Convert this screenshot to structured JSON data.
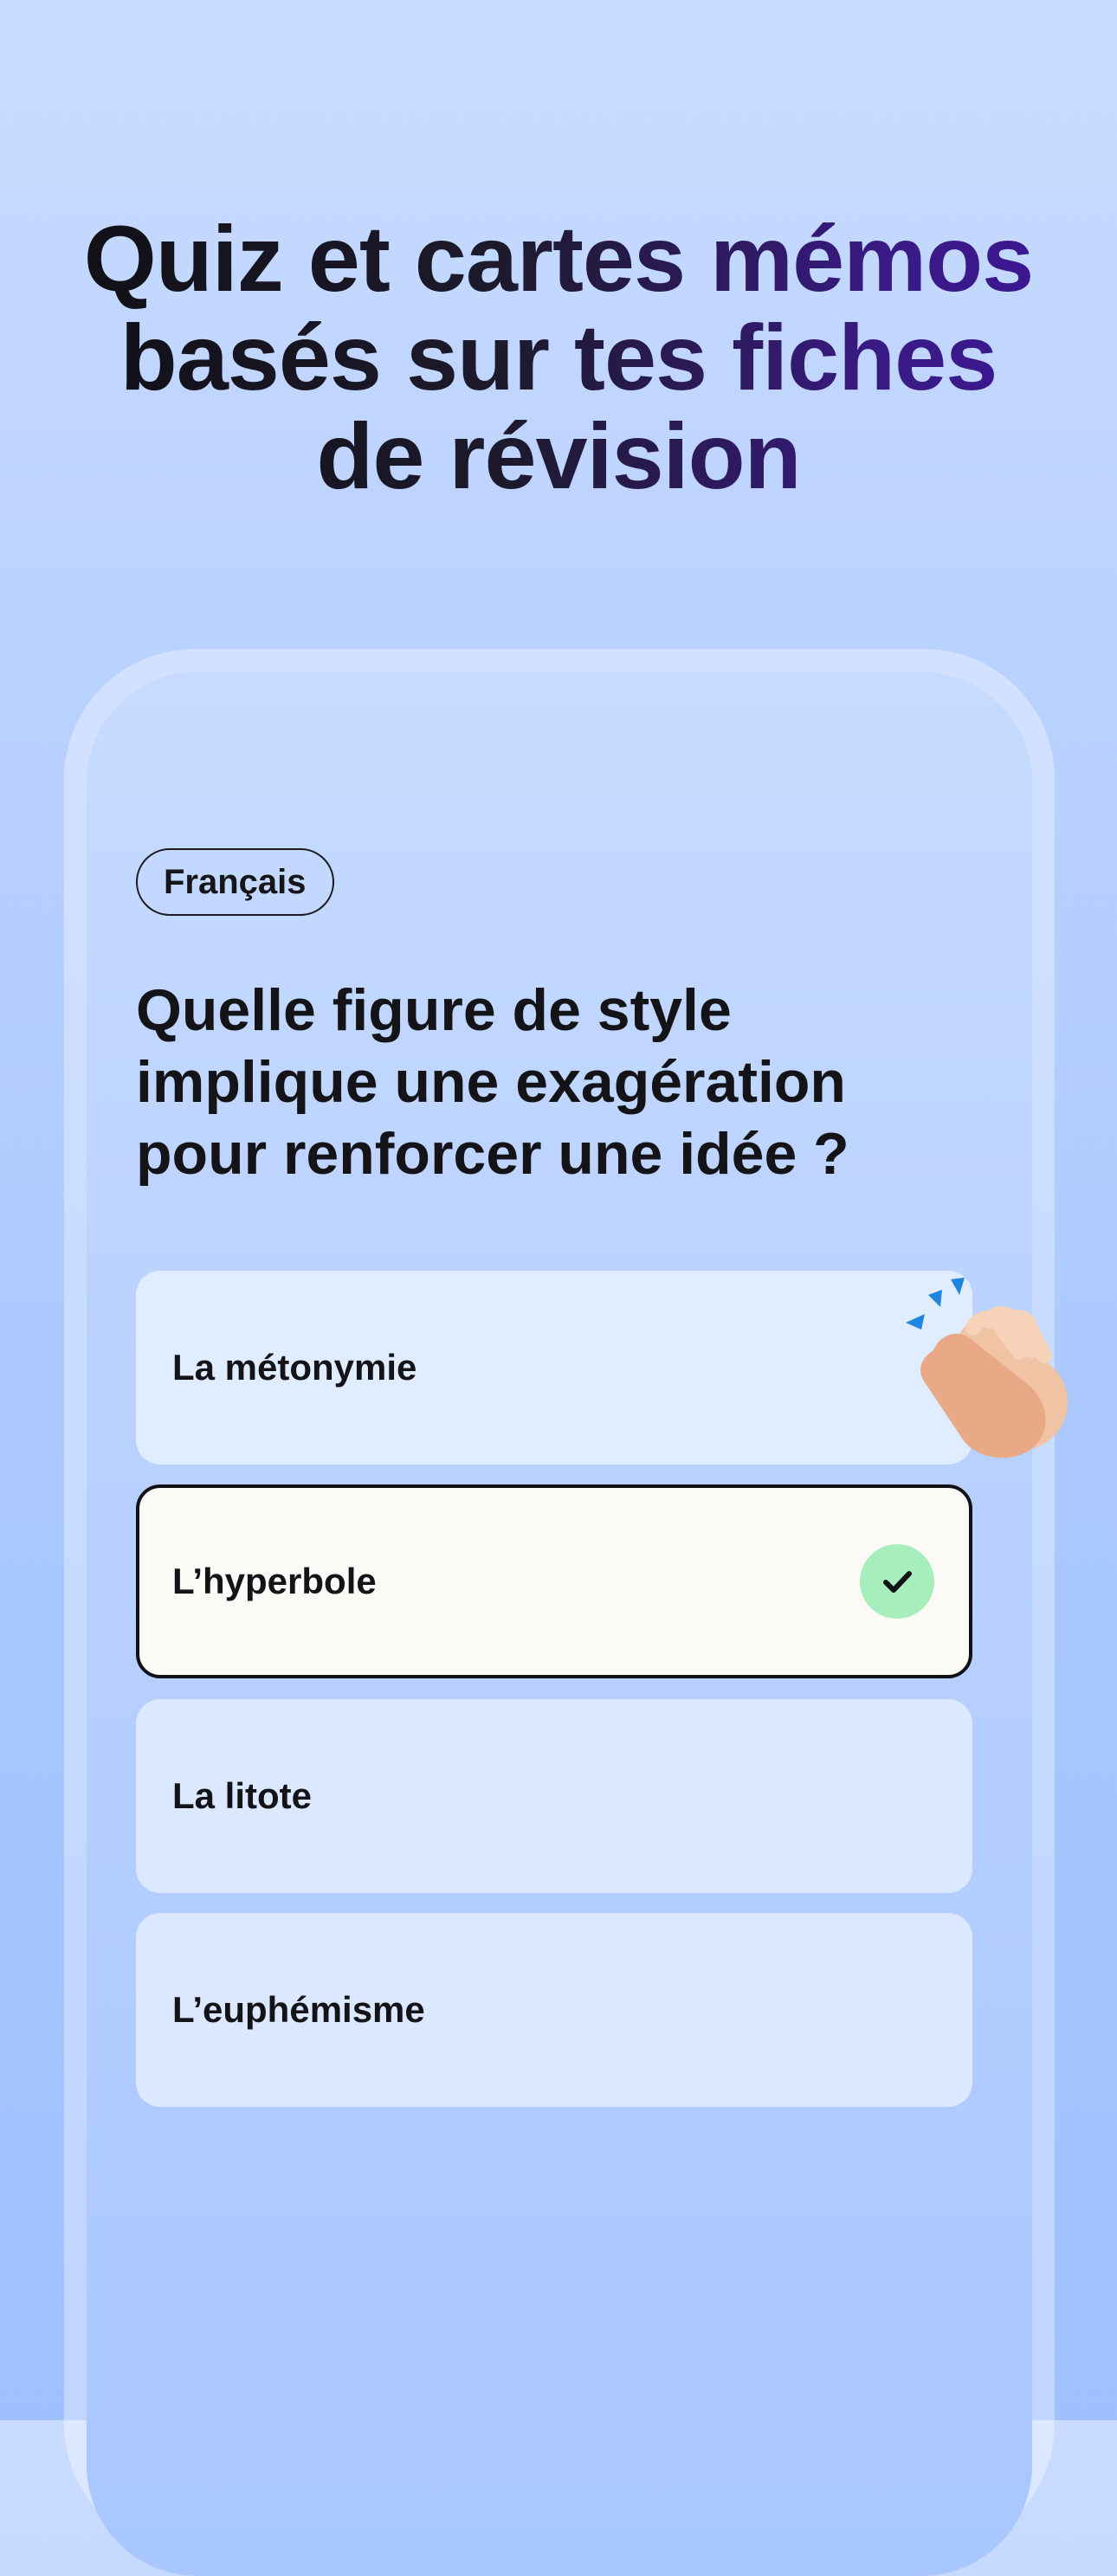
{
  "headline": {
    "line1": "Quiz et cartes mémos",
    "line2": "basés sur tes fiches",
    "line3": "de révision"
  },
  "quiz": {
    "subject": "Français",
    "question": "Quelle figure de style implique une exagération pour renforcer une idée ?",
    "answers": [
      {
        "label": "La métonymie",
        "selected": false
      },
      {
        "label": "L’hyperbole",
        "selected": true,
        "correct": true
      },
      {
        "label": "La litote",
        "selected": false
      },
      {
        "label": "L’euphémisme",
        "selected": false
      }
    ]
  },
  "icons": {
    "check": "check-icon",
    "clap": "clapping-hands-icon"
  },
  "colors": {
    "background_top": "#c9dcff",
    "background_bottom": "#9fc0ff",
    "headline_accent": "#3d1596",
    "answer_bg": "#dbe8ff",
    "selected_bg": "#fbfaf7",
    "check_bg": "#a6efbd"
  }
}
